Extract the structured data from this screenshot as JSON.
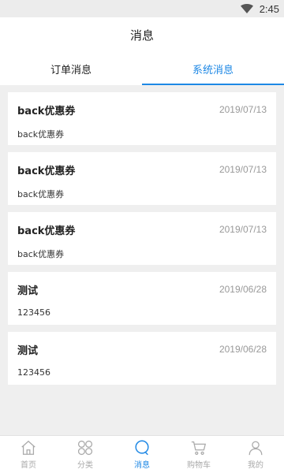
{
  "status_bar": {
    "time": "2:45"
  },
  "header": {
    "title": "消息"
  },
  "tabs": [
    {
      "label": "订单消息",
      "active": false
    },
    {
      "label": "系统消息",
      "active": true
    }
  ],
  "messages": [
    {
      "title": "back优惠券",
      "date": "2019/07/13",
      "body": "back优惠券"
    },
    {
      "title": "back优惠券",
      "date": "2019/07/13",
      "body": "back优惠券"
    },
    {
      "title": "back优惠券",
      "date": "2019/07/13",
      "body": "back优惠券"
    },
    {
      "title": "测试",
      "date": "2019/06/28",
      "body": "123456"
    },
    {
      "title": "测试",
      "date": "2019/06/28",
      "body": "123456"
    }
  ],
  "bottom_nav": [
    {
      "label": "首页",
      "icon": "home-icon",
      "active": false
    },
    {
      "label": "分类",
      "icon": "category-icon",
      "active": false
    },
    {
      "label": "消息",
      "icon": "message-icon",
      "active": true
    },
    {
      "label": "购物车",
      "icon": "cart-icon",
      "active": false
    },
    {
      "label": "我的",
      "icon": "user-icon",
      "active": false
    }
  ],
  "colors": {
    "accent": "#1e88e5",
    "inactive": "#aaaaaa",
    "background": "#efefef"
  }
}
